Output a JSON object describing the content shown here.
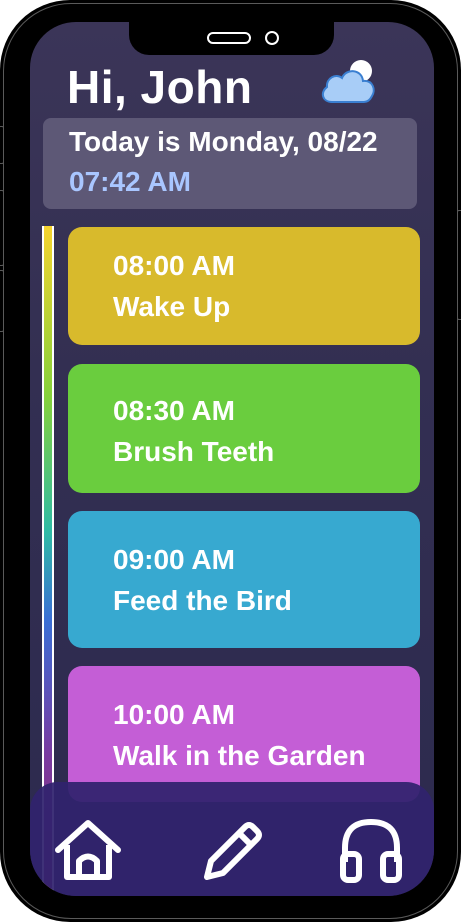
{
  "header": {
    "greeting": "Hi, John",
    "weather_icon": "cloud-moon-icon"
  },
  "date_card": {
    "date": "Today is Monday, 08/22",
    "time": "07:42 AM"
  },
  "events": [
    {
      "time": "08:00 AM",
      "title": "Wake Up",
      "color": "#d8ba2c"
    },
    {
      "time": "08:30 AM",
      "title": "Brush Teeth",
      "color": "#6acd3e"
    },
    {
      "time": "09:00 AM",
      "title": "Feed the Bird",
      "color": "#37a9d0"
    },
    {
      "time": "10:00 AM",
      "title": "Walk in the Garden",
      "color": "#c45ed6"
    }
  ],
  "nav": [
    {
      "icon": "home-icon"
    },
    {
      "icon": "pencil-icon"
    },
    {
      "icon": "headphones-icon"
    }
  ],
  "colors": {
    "background": "#35305a",
    "nav_bar": "#30226e",
    "time_accent": "#a9c6ff"
  }
}
